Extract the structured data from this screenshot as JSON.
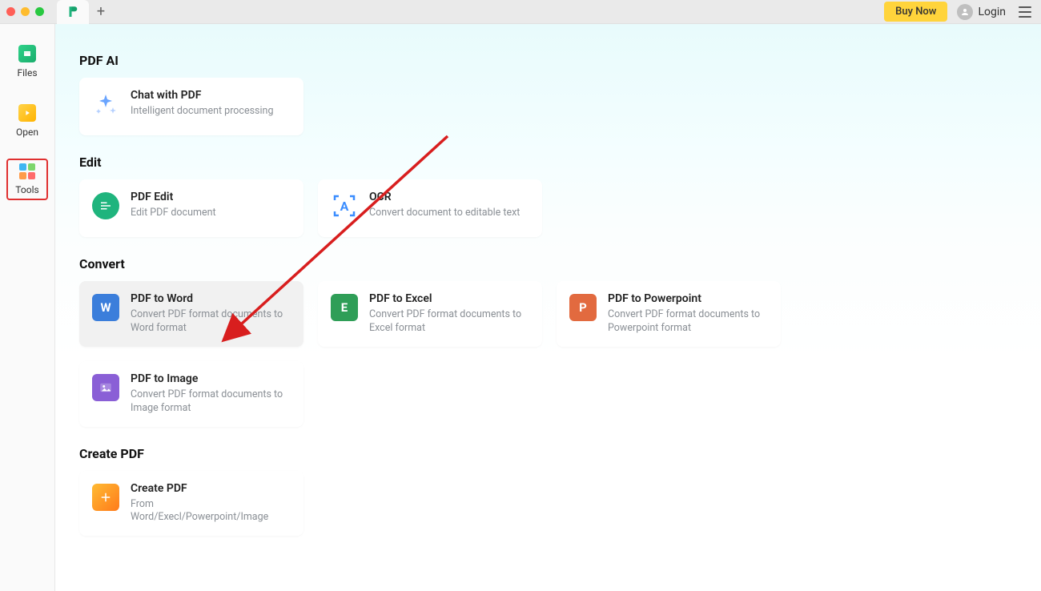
{
  "titlebar": {
    "buy_label": "Buy Now",
    "login_label": "Login"
  },
  "sidebar": {
    "items": [
      {
        "label": "Files"
      },
      {
        "label": "Open"
      },
      {
        "label": "Tools"
      }
    ]
  },
  "sections": {
    "pdf_ai": {
      "title": "PDF AI",
      "chat": {
        "title": "Chat with PDF",
        "desc": "Intelligent document processing"
      }
    },
    "edit": {
      "title": "Edit",
      "pdf_edit": {
        "title": "PDF Edit",
        "desc": "Edit PDF document"
      },
      "ocr": {
        "title": "OCR",
        "desc": "Convert document to editable text"
      }
    },
    "convert": {
      "title": "Convert",
      "word": {
        "title": "PDF to Word",
        "desc": "Convert PDF format documents to Word format"
      },
      "excel": {
        "title": "PDF to Excel",
        "desc": "Convert PDF format documents to Excel format"
      },
      "ppt": {
        "title": "PDF to Powerpoint",
        "desc": "Convert PDF format documents to Powerpoint format"
      },
      "image": {
        "title": "PDF to Image",
        "desc": "Convert PDF format documents to Image format"
      }
    },
    "create": {
      "title": "Create PDF",
      "create": {
        "title": "Create PDF",
        "desc": "From Word/Execl/Powerpoint/Image"
      }
    }
  }
}
